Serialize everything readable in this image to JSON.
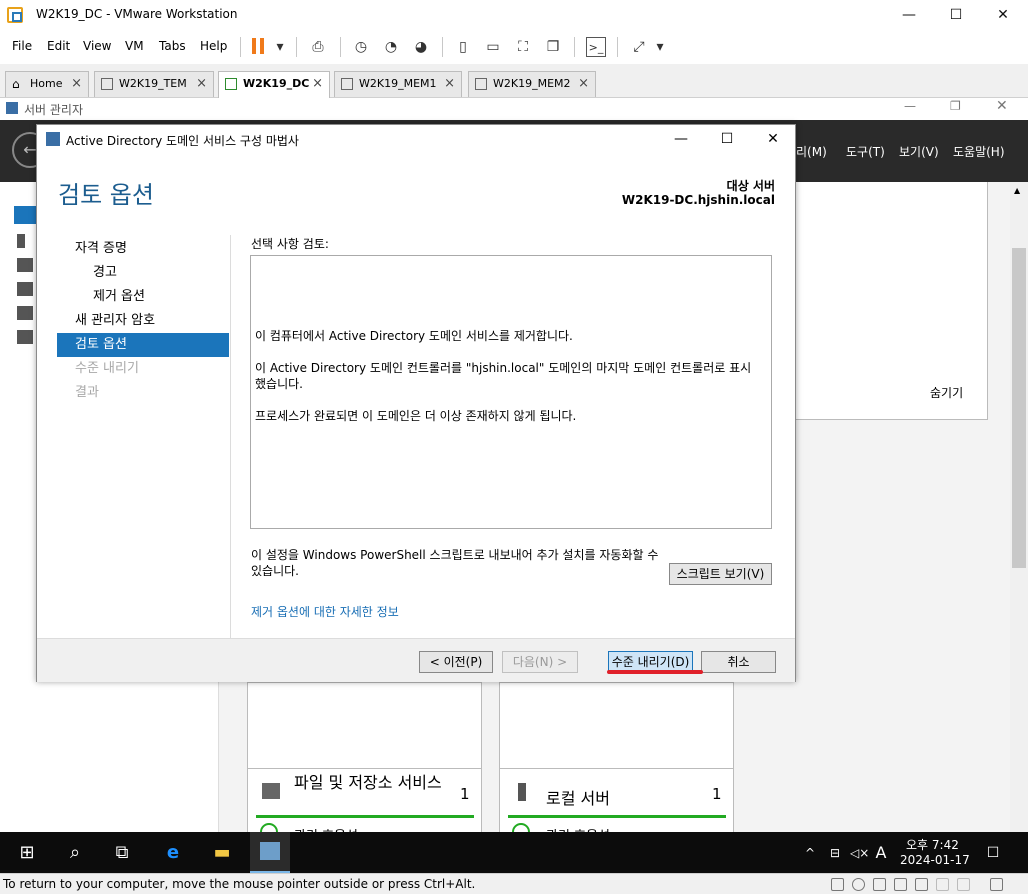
{
  "vmware": {
    "window_title": "W2K19_DC - VMware Workstation",
    "menu": [
      "File",
      "Edit",
      "View",
      "VM",
      "Tabs",
      "Help"
    ],
    "tabs": [
      {
        "label": "Home"
      },
      {
        "label": "W2K19_TEM"
      },
      {
        "label": "W2K19_DC"
      },
      {
        "label": "W2K19_MEM1"
      },
      {
        "label": "W2K19_MEM2"
      }
    ],
    "status_message": "To return to your computer, move the mouse pointer outside or press Ctrl+Alt."
  },
  "server_manager": {
    "title": "서버 관리자",
    "header_menus": [
      "리(M)",
      "도구(T)",
      "보기(V)",
      "도움말(H)"
    ],
    "hide_label": "숨기기",
    "tiles": [
      {
        "title": "파일 및 저장소 서비스",
        "count": "1",
        "status": "관리 효율성"
      },
      {
        "title": "로컬 서버",
        "count": "1",
        "status": "관리 효율성"
      }
    ]
  },
  "dialog": {
    "title": "Active Directory 도메인 서비스 구성 마법사",
    "heading": "검토 옵션",
    "target_label": "대상 서버",
    "target_server": "W2K19-DC.hjshin.local",
    "steps": [
      {
        "label": "자격 증명"
      },
      {
        "label": "경고"
      },
      {
        "label": "제거 옵션"
      },
      {
        "label": "새 관리자 암호"
      },
      {
        "label": "검토 옵션"
      },
      {
        "label": "수준 내리기"
      },
      {
        "label": "결과"
      }
    ],
    "review_label": "선택 사항 검토:",
    "review_lines": [
      "이 컴퓨터에서 Active Directory 도메인 서비스를 제거합니다.",
      "이 Active Directory 도메인 컨트롤러를 \"hjshin.local\" 도메인의 마지막 도메인 컨트롤러로 표시했습니다.",
      "프로세스가 완료되면 이 도메인은 더 이상 존재하지 않게 됩니다."
    ],
    "export_text": "이 설정을 Windows PowerShell 스크립트로 내보내어 추가 설치를 자동화할 수 있습니다.",
    "script_button": "스크립트 보기(V)",
    "more_link": "제거 옵션에 대한 자세한 정보",
    "buttons": {
      "prev": "< 이전(P)",
      "next": "다음(N) >",
      "demote": "수준 내리기(D)",
      "cancel": "취소"
    }
  },
  "taskbar": {
    "time": "오후 7:42",
    "date": "2024-01-17",
    "ime": "A"
  },
  "colors": {
    "accent": "#1b75bb",
    "heading": "#1c5d8f",
    "highlight_underline": "#e0202a",
    "status_green": "#22aa22"
  }
}
